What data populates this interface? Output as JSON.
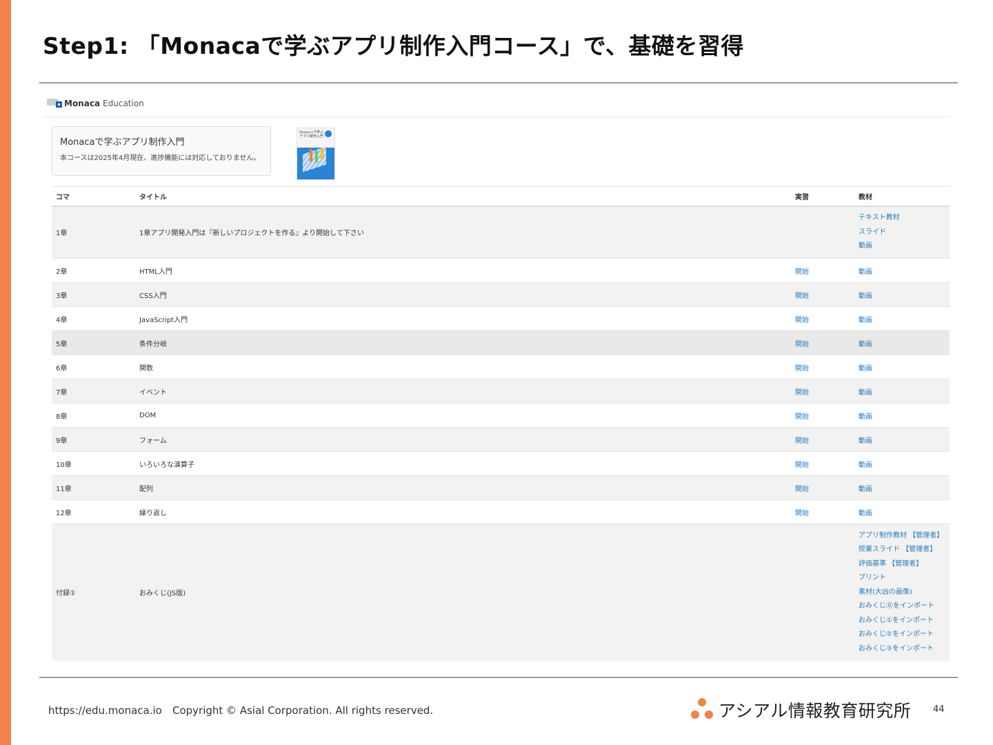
{
  "slide": {
    "title": "Step1: 「Monacaで学ぶアプリ制作入門コース」で、基礎を習得",
    "accent_color": "#f0824a"
  },
  "screenshot": {
    "brand": {
      "name": "Monaca",
      "sub": "Education"
    },
    "course": {
      "title": "Monacaで学ぶアプリ制作入門",
      "note": "本コースは2025年4月現在、進捗機能には対応しておりません。"
    },
    "book": {
      "title": "Monacaで学ぶアプリ制作入門"
    },
    "table": {
      "headers": {
        "koma": "コマ",
        "title": "タイトル",
        "practice": "実習",
        "materials": "教材"
      },
      "rows": [
        {
          "koma": "1章",
          "title": "1章アプリ開発入門は『新しいプロジェクトを作る』より開始して下さい",
          "practice": "",
          "materials": [
            "テキスト教材",
            "スライド",
            "動画"
          ]
        },
        {
          "koma": "2章",
          "title": "HTML入門",
          "practice": "開始",
          "materials": [
            "動画"
          ]
        },
        {
          "koma": "3章",
          "title": "CSS入門",
          "practice": "開始",
          "materials": [
            "動画"
          ]
        },
        {
          "koma": "4章",
          "title": "JavaScript入門",
          "practice": "開始",
          "materials": [
            "動画"
          ]
        },
        {
          "koma": "5章",
          "title": "条件分岐",
          "practice": "開始",
          "materials": [
            "動画"
          ]
        },
        {
          "koma": "6章",
          "title": "関数",
          "practice": "開始",
          "materials": [
            "動画"
          ]
        },
        {
          "koma": "7章",
          "title": "イベント",
          "practice": "開始",
          "materials": [
            "動画"
          ]
        },
        {
          "koma": "8章",
          "title": "DOM",
          "practice": "開始",
          "materials": [
            "動画"
          ]
        },
        {
          "koma": "9章",
          "title": "フォーム",
          "practice": "開始",
          "materials": [
            "動画"
          ]
        },
        {
          "koma": "10章",
          "title": "いろいろな演算子",
          "practice": "開始",
          "materials": [
            "動画"
          ]
        },
        {
          "koma": "11章",
          "title": "配列",
          "practice": "開始",
          "materials": [
            "動画"
          ]
        },
        {
          "koma": "12章",
          "title": "繰り返し",
          "practice": "開始",
          "materials": [
            "動画"
          ]
        },
        {
          "koma": "付録①",
          "title": "おみくじ(JS版)",
          "practice": "",
          "materials": [
            "アプリ制作教材 【管理者】",
            "授業スライド 【管理者】",
            "評価基準 【管理者】",
            "プリント",
            "素材(大凶の画像)",
            "おみくじ⓪をインポート",
            "おみくじ①をインポート",
            "おみくじ②をインポート",
            "おみくじ③をインポート"
          ]
        }
      ]
    }
  },
  "footer": {
    "url": "https://edu.monaca.io",
    "copyright": "Copyright © Asial Corporation. All rights reserved.",
    "org": "アシアル情報教育研究所",
    "page": "44"
  }
}
